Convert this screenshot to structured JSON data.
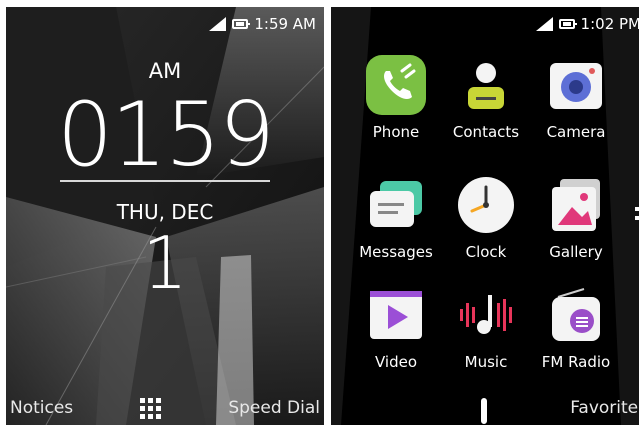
{
  "lock_screen": {
    "status": {
      "time": "1:59 AM"
    },
    "clock": {
      "ampm": "AM",
      "time": "0159",
      "date": "THU, DEC",
      "day": "1"
    },
    "softkeys": {
      "left": "Notices",
      "right": "Speed Dial",
      "center_icon": "app-grid-icon"
    }
  },
  "home_screen": {
    "status": {
      "time": "1:02 PM"
    },
    "apps": [
      {
        "label": "Phone",
        "icon": "phone-icon",
        "color": "#7bc043"
      },
      {
        "label": "Contacts",
        "icon": "contacts-icon",
        "color": "#c8d636"
      },
      {
        "label": "Camera",
        "icon": "camera-icon",
        "color": "#5d6fd6"
      },
      {
        "label": "Messages",
        "icon": "messages-icon",
        "color": "#4cc9a6"
      },
      {
        "label": "Clock",
        "icon": "clock-icon",
        "color": "#f5a623"
      },
      {
        "label": "Gallery",
        "icon": "gallery-icon",
        "color": "#e0387a"
      },
      {
        "label": "Video",
        "icon": "video-icon",
        "color": "#9b4fd6"
      },
      {
        "label": "Music",
        "icon": "music-icon",
        "color": "#e8355a"
      },
      {
        "label": "FM Radio",
        "icon": "radio-icon",
        "color": "#9a4ec8"
      }
    ],
    "softkeys": {
      "center_icon": "home-icon",
      "right": "Favorites"
    }
  }
}
